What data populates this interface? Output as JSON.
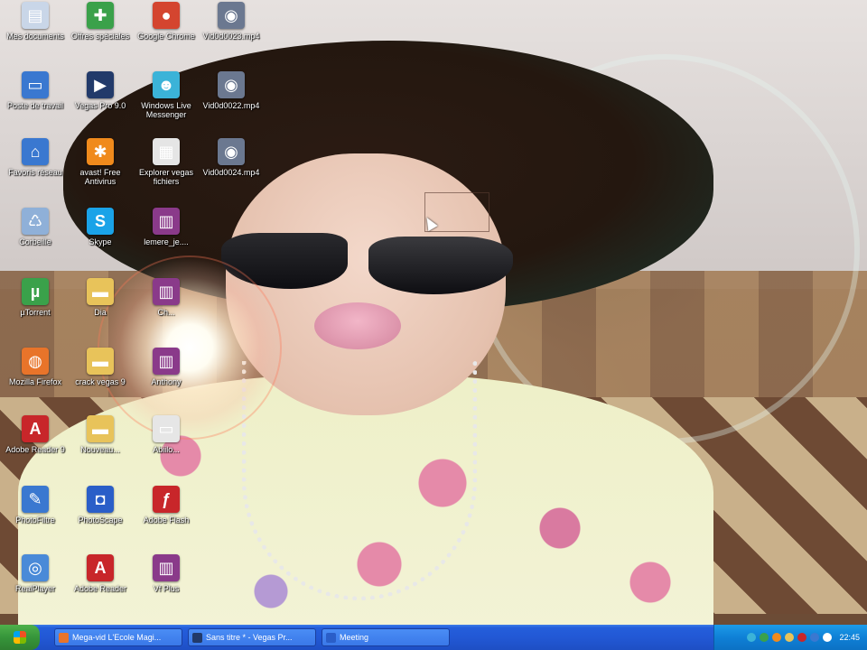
{
  "desktop": {
    "icons": [
      {
        "id": "my-documents",
        "label": "Mes documents",
        "glyph": "folder-doc-icon",
        "symbol": "▤",
        "color": "#c9d6e8",
        "col": 0,
        "row": 0
      },
      {
        "id": "offres-speciales",
        "label": "Offres spéciales",
        "glyph": "gift-icon",
        "symbol": "✚",
        "color": "#3aa14a",
        "col": 1,
        "row": 0
      },
      {
        "id": "google-chrome",
        "label": "Google Chrome",
        "glyph": "chrome-icon",
        "symbol": "●",
        "color": "#d4452f",
        "col": 2,
        "row": 0
      },
      {
        "id": "vid-mpeg-1",
        "label": "Vid0d0023.mp4",
        "glyph": "media-file-icon",
        "symbol": "◉",
        "color": "#6b7890",
        "col": 3,
        "row": 0
      },
      {
        "id": "poste-de-travail",
        "label": "Poste de travail",
        "glyph": "computer-icon",
        "symbol": "▭",
        "color": "#3a78d0",
        "col": 0,
        "row": 1
      },
      {
        "id": "vegas-pro",
        "label": "Vegas Pro 9.0",
        "glyph": "vegas-icon",
        "symbol": "▶",
        "color": "#223a6a",
        "col": 1,
        "row": 1
      },
      {
        "id": "windows-live-messenger",
        "label": "Windows Live Messenger",
        "glyph": "messenger-icon",
        "symbol": "☻",
        "color": "#3bb3d8",
        "col": 2,
        "row": 1
      },
      {
        "id": "vid-mp4-2",
        "label": "Vid0d0022.mp4",
        "glyph": "media-file-icon",
        "symbol": "◉",
        "color": "#6b7890",
        "col": 3,
        "row": 1
      },
      {
        "id": "favoris-reseau",
        "label": "Favoris réseau",
        "glyph": "network-icon",
        "symbol": "⌂",
        "color": "#3a78d0",
        "col": 0,
        "row": 2
      },
      {
        "id": "avast-antivirus",
        "label": "avast! Free Antivirus",
        "glyph": "avast-icon",
        "symbol": "✱",
        "color": "#f08a1c",
        "col": 1,
        "row": 2
      },
      {
        "id": "explorer-fichiers",
        "label": "Explorer vegas fichiers",
        "glyph": "explorer-icon",
        "symbol": "▦",
        "color": "#e5e5e5",
        "col": 2,
        "row": 2
      },
      {
        "id": "vid-mp4-3",
        "label": "Vid0d0024.mp4",
        "glyph": "media-file-icon",
        "symbol": "◉",
        "color": "#6b7890",
        "col": 3,
        "row": 2
      },
      {
        "id": "corbeille",
        "label": "Corbeille",
        "glyph": "recycle-bin-icon",
        "symbol": "♺",
        "color": "#8fb0d8",
        "col": 0,
        "row": 3
      },
      {
        "id": "skype",
        "label": "Skype",
        "glyph": "skype-icon",
        "symbol": "S",
        "color": "#1aa3e8",
        "col": 1,
        "row": 3
      },
      {
        "id": "winrar-archive",
        "label": "lemere_je....",
        "glyph": "winrar-icon",
        "symbol": "▥",
        "color": "#8a3a8a",
        "col": 2,
        "row": 3
      },
      {
        "id": "utorrent",
        "label": "µTorrent",
        "glyph": "utorrent-icon",
        "symbol": "µ",
        "color": "#3aa14a",
        "col": 0,
        "row": 4
      },
      {
        "id": "folder-1",
        "label": "Dia",
        "glyph": "folder-icon",
        "symbol": "▬",
        "color": "#e8c35a",
        "col": 1,
        "row": 4
      },
      {
        "id": "winrar-2",
        "label": "Ch...",
        "glyph": "winrar-icon",
        "symbol": "▥",
        "color": "#8a3a8a",
        "col": 2,
        "row": 4
      },
      {
        "id": "mozilla-firefox",
        "label": "Mozilla Firefox",
        "glyph": "firefox-icon",
        "symbol": "◍",
        "color": "#e8742a",
        "col": 0,
        "row": 5
      },
      {
        "id": "crack-vegas",
        "label": "crack vegas 9",
        "glyph": "folder-icon",
        "symbol": "▬",
        "color": "#e8c35a",
        "col": 1,
        "row": 5
      },
      {
        "id": "winrar-3",
        "label": "Anthony",
        "glyph": "winrar-icon",
        "symbol": "▥",
        "color": "#8a3a8a",
        "col": 2,
        "row": 5
      },
      {
        "id": "adobe-reader-9",
        "label": "Adobe Reader 9",
        "glyph": "adobe-icon",
        "symbol": "A",
        "color": "#c8262a",
        "col": 0,
        "row": 6
      },
      {
        "id": "folder-3",
        "label": "Nouveau...",
        "glyph": "folder-icon",
        "symbol": "▬",
        "color": "#e8c35a",
        "col": 1,
        "row": 6
      },
      {
        "id": "document-1",
        "label": "Abiilo...",
        "glyph": "document-icon",
        "symbol": "▭",
        "color": "#e6e6e6",
        "col": 2,
        "row": 6
      },
      {
        "id": "photofiltre",
        "label": "PhotoFiltre",
        "glyph": "photofiltre-icon",
        "symbol": "✎",
        "color": "#3a78d0",
        "col": 0,
        "row": 7
      },
      {
        "id": "photoscape",
        "label": "PhotoScape",
        "glyph": "photoscape-icon",
        "symbol": "◘",
        "color": "#2a5ec8",
        "col": 1,
        "row": 7
      },
      {
        "id": "adobe-flash",
        "label": "Adobe Flash",
        "glyph": "flash-icon",
        "symbol": "ƒ",
        "color": "#c8262a",
        "col": 2,
        "row": 7
      },
      {
        "id": "realplayer",
        "label": "RealPlayer",
        "glyph": "realplayer-icon",
        "symbol": "◎",
        "color": "#4a8ad8",
        "col": 0,
        "row": 8
      },
      {
        "id": "adobe-reader",
        "label": "Adobe Reader",
        "glyph": "adobe-reader-icon",
        "symbol": "A",
        "color": "#c8262a",
        "col": 1,
        "row": 8
      },
      {
        "id": "winrar-4",
        "label": "Vf Plus",
        "glyph": "winrar-icon",
        "symbol": "▥",
        "color": "#8a3a8a",
        "col": 2,
        "row": 8
      }
    ]
  },
  "taskbar": {
    "start_label": "",
    "tasks": [
      {
        "label": "Mega-vid L'Ecole Magi...",
        "color": "#e8742a",
        "icon": "firefox-icon"
      },
      {
        "label": "Sans titre * - Vegas Pr...",
        "color": "#223a6a",
        "icon": "vegas-icon"
      },
      {
        "label": "Meeting",
        "color": "#2a5ec8",
        "icon": "photoscape-icon"
      }
    ],
    "tray": {
      "icon_colors": [
        "#3bb3d8",
        "#3aa14a",
        "#f08a1c",
        "#e8c35a",
        "#c8262a",
        "#3a78d0",
        "#ffffff"
      ],
      "clock": "22:45"
    }
  }
}
